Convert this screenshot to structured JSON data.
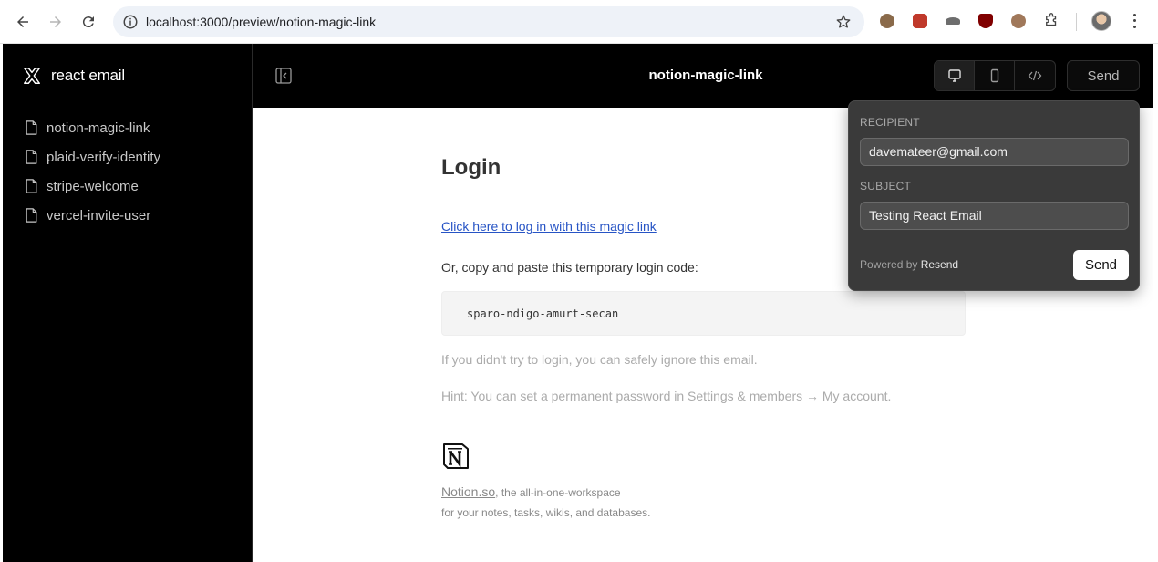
{
  "browser": {
    "url": "localhost:3000/preview/notion-magic-link"
  },
  "sidebar": {
    "brand": "react email",
    "items": [
      {
        "label": "notion-magic-link"
      },
      {
        "label": "plaid-verify-identity"
      },
      {
        "label": "stripe-welcome"
      },
      {
        "label": "vercel-invite-user"
      }
    ]
  },
  "topbar": {
    "title": "notion-magic-link",
    "send_label": "Send",
    "view_modes": [
      "desktop",
      "mobile",
      "code"
    ],
    "active_view": "desktop"
  },
  "email": {
    "heading": "Login",
    "magic_link": "Click here to log in with this magic link",
    "copy_text": "Or, copy and paste this temporary login code:",
    "code": "sparo-ndigo-amurt-secan",
    "ignore_text": "If you didn't try to login, you can safely ignore this email.",
    "hint_text": "Hint: You can set a permanent password in Settings & members → My account.",
    "footer_link": "Notion.so",
    "footer_line1_rest": ", the all-in-one-workspace",
    "footer_line2": "for your notes, tasks, wikis, and databases."
  },
  "popover": {
    "recipient_label": "RECIPIENT",
    "recipient_value": "davemateer@gmail.com",
    "subject_label": "SUBJECT",
    "subject_value": "Testing React Email",
    "powered_prefix": "Powered by",
    "powered_brand": "Resend",
    "send_label": "Send"
  },
  "colors": {
    "sidebar_bg": "#000000",
    "link": "#2754c5",
    "popover_bg": "#3a3a3a"
  }
}
